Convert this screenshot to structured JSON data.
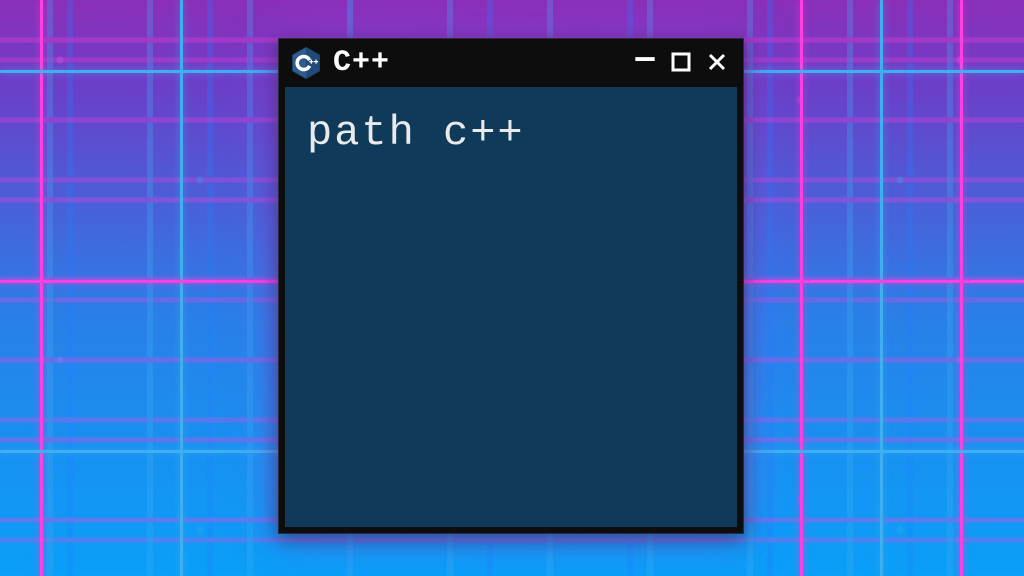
{
  "window": {
    "title": "C++",
    "icon": "cpp-hexagon-icon",
    "controls": {
      "minimize": "–",
      "maximize": "▢",
      "close": "✕"
    }
  },
  "terminal": {
    "content": "path c++"
  },
  "colors": {
    "titlebar": "#0d0d0d",
    "client_bg": "#0f3a5a",
    "title_text": "#ffffff",
    "terminal_text": "#eaeaea"
  }
}
